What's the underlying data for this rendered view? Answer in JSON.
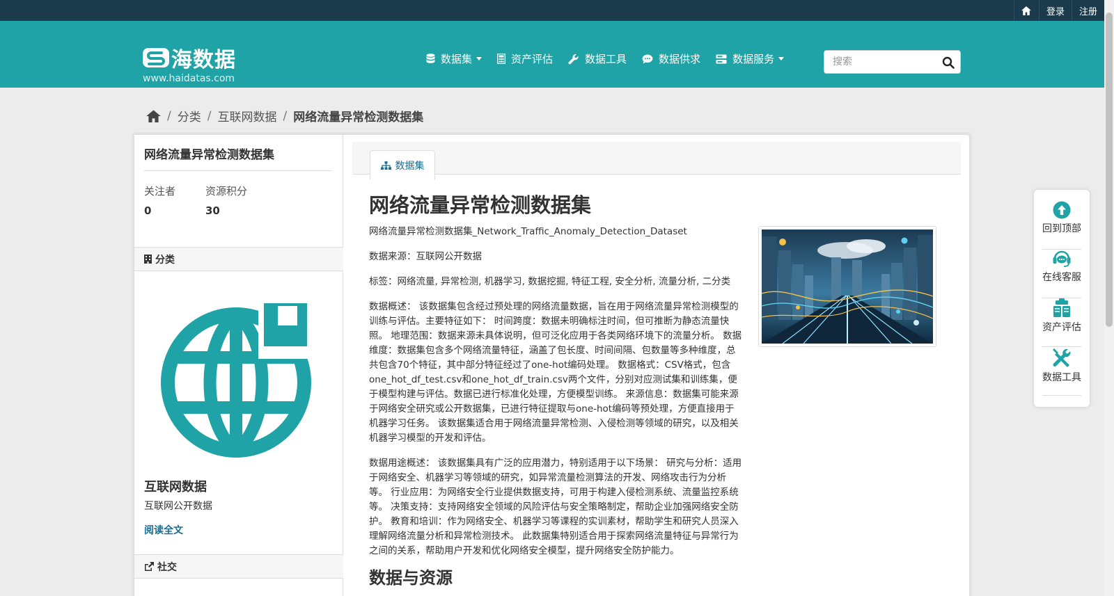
{
  "colors": {
    "teal": "#1fa3a6",
    "navy": "#1b3a4b",
    "link": "#1a6d8f"
  },
  "topbar": {
    "home_icon": "home-icon",
    "login": "登录",
    "register": "注册"
  },
  "brand": {
    "name": "海数据",
    "url": "www.haidatas.com"
  },
  "nav": {
    "items": [
      {
        "label": "数据集",
        "icon": "database-icon",
        "dropdown": true
      },
      {
        "label": "资产评估",
        "icon": "calculator-icon",
        "dropdown": false
      },
      {
        "label": "数据工具",
        "icon": "wrench-icon",
        "dropdown": false
      },
      {
        "label": "数据供求",
        "icon": "comment-icon",
        "dropdown": false
      },
      {
        "label": "数据服务",
        "icon": "server-icon",
        "dropdown": true
      }
    ]
  },
  "search": {
    "placeholder": "搜索",
    "value": ""
  },
  "breadcrumb": {
    "items": [
      "分类",
      "互联网数据"
    ],
    "current": "网络流量异常检测数据集"
  },
  "aside": {
    "title": "网络流量异常检测数据集",
    "followers_label": "关注者",
    "followers_value": "0",
    "points_label": "资源积分",
    "points_value": "30",
    "category_heading": "分类",
    "org_name": "互联网数据",
    "org_desc": "互联网公开数据",
    "read_more": "阅读全文",
    "social_heading": "社交"
  },
  "main": {
    "tab_label": "数据集",
    "heading": "网络流量异常检测数据集",
    "paragraphs": [
      "网络流量异常检测数据集_Network_Traffic_Anomaly_Detection_Dataset",
      "数据来源：互联网公开数据",
      "标签：网络流量, 异常检测, 机器学习, 数据挖掘, 特征工程, 安全分析, 流量分析, 二分类",
      "数据概述： 该数据集包含经过预处理的网络流量数据，旨在用于网络流量异常检测模型的训练与评估。主要特征如下： 时间跨度：数据未明确标注时间，但可推断为静态流量快照。 地理范围：数据来源未具体说明，但可泛化应用于各类网络环境下的流量分析。 数据维度：数据集包含多个网络流量特征，涵盖了包长度、时间间隔、包数量等多种维度，总共包含70个特征，其中部分特征经过了one-hot编码处理。 数据格式：CSV格式，包含one_hot_df_test.csv和one_hot_df_train.csv两个文件，分别对应测试集和训练集，便于模型构建与评估。数据已进行标准化处理，方便模型训练。 来源信息：数据集可能来源于网络安全研究或公开数据集，已进行特征提取与one-hot编码等预处理，方便直接用于机器学习任务。 该数据集适合用于网络流量异常检测、入侵检测等领域的研究，以及相关机器学习模型的开发和评估。",
      "数据用途概述： 该数据集具有广泛的应用潜力，特别适用于以下场景： 研究与分析：适用于网络安全、机器学习等领域的研究，如异常流量检测算法的开发、网络攻击行为分析等。 行业应用：为网络安全行业提供数据支持，可用于构建入侵检测系统、流量监控系统等。 决策支持：支持网络安全领域的风险评估与安全策略制定，帮助企业加强网络安全防护。 教育和培训：作为网络安全、机器学习等课程的实训素材，帮助学生和研究人员深入理解网络流量分析和异常检测技术。 此数据集特别适合用于探索网络流量特征与异常行为之间的关系，帮助用户开发和优化网络安全模型，提升网络安全防护能力。"
    ],
    "section_heading": "数据与资源"
  },
  "float_panel": [
    {
      "label": "回到顶部",
      "icon": "arrow-up-circle-icon"
    },
    {
      "label": "在线客服",
      "icon": "headset-icon"
    },
    {
      "label": "资产评估",
      "icon": "clipboard-icon"
    },
    {
      "label": "数据工具",
      "icon": "tools-icon"
    }
  ]
}
